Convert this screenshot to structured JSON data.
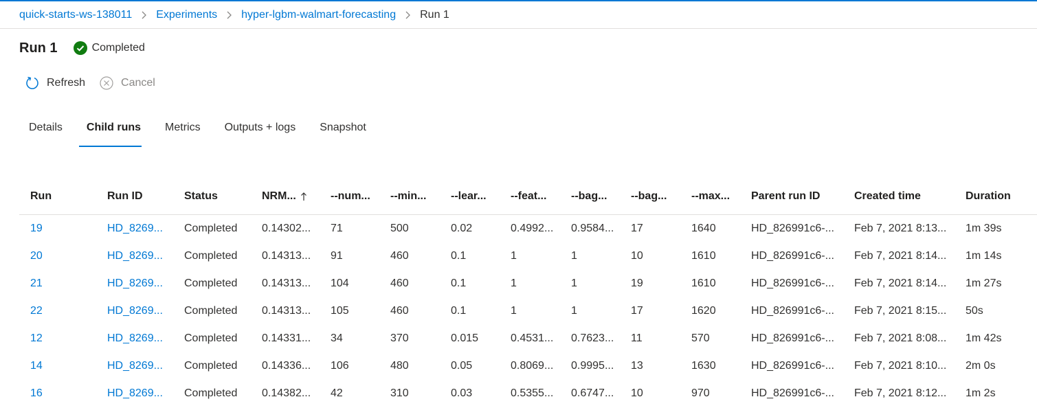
{
  "breadcrumb": {
    "items": [
      "quick-starts-ws-138011",
      "Experiments",
      "hyper-lgbm-walmart-forecasting"
    ],
    "current": "Run 1"
  },
  "header": {
    "title": "Run 1",
    "status": "Completed",
    "status_color": "#107c10"
  },
  "toolbar": {
    "refresh_label": "Refresh",
    "cancel_label": "Cancel"
  },
  "tabs": [
    "Details",
    "Child runs",
    "Metrics",
    "Outputs + logs",
    "Snapshot"
  ],
  "active_tab": "Child runs",
  "table": {
    "columns": [
      "Run",
      "Run ID",
      "Status",
      "NRM...",
      "--num...",
      "--min...",
      "--lear...",
      "--feat...",
      "--bag...",
      "--bag...",
      "--max...",
      "Parent run ID",
      "Created time",
      "Duration"
    ],
    "sorted_column": "NRM...",
    "sort_direction": "ascending",
    "rows": [
      [
        "19",
        "HD_8269...",
        "Completed",
        "0.14302...",
        "71",
        "500",
        "0.02",
        "0.4992...",
        "0.9584...",
        "17",
        "1640",
        "HD_826991c6-...",
        "Feb 7, 2021 8:13...",
        "1m 39s"
      ],
      [
        "20",
        "HD_8269...",
        "Completed",
        "0.14313...",
        "91",
        "460",
        "0.1",
        "1",
        "1",
        "10",
        "1610",
        "HD_826991c6-...",
        "Feb 7, 2021 8:14...",
        "1m 14s"
      ],
      [
        "21",
        "HD_8269...",
        "Completed",
        "0.14313...",
        "104",
        "460",
        "0.1",
        "1",
        "1",
        "19",
        "1610",
        "HD_826991c6-...",
        "Feb 7, 2021 8:14...",
        "1m 27s"
      ],
      [
        "22",
        "HD_8269...",
        "Completed",
        "0.14313...",
        "105",
        "460",
        "0.1",
        "1",
        "1",
        "17",
        "1620",
        "HD_826991c6-...",
        "Feb 7, 2021 8:15...",
        "50s"
      ],
      [
        "12",
        "HD_8269...",
        "Completed",
        "0.14331...",
        "34",
        "370",
        "0.015",
        "0.4531...",
        "0.7623...",
        "11",
        "570",
        "HD_826991c6-...",
        "Feb 7, 2021 8:08...",
        "1m 42s"
      ],
      [
        "14",
        "HD_8269...",
        "Completed",
        "0.14336...",
        "106",
        "480",
        "0.05",
        "0.8069...",
        "0.9995...",
        "13",
        "1630",
        "HD_826991c6-...",
        "Feb 7, 2021 8:10...",
        "2m 0s"
      ],
      [
        "16",
        "HD_8269...",
        "Completed",
        "0.14382...",
        "42",
        "310",
        "0.03",
        "0.5355...",
        "0.6747...",
        "10",
        "970",
        "HD_826991c6-...",
        "Feb 7, 2021 8:12...",
        "1m 2s"
      ]
    ]
  },
  "colors": {
    "accent": "#0078d4",
    "success": "#107c10",
    "text": "#323130",
    "muted": "#8a8886"
  }
}
